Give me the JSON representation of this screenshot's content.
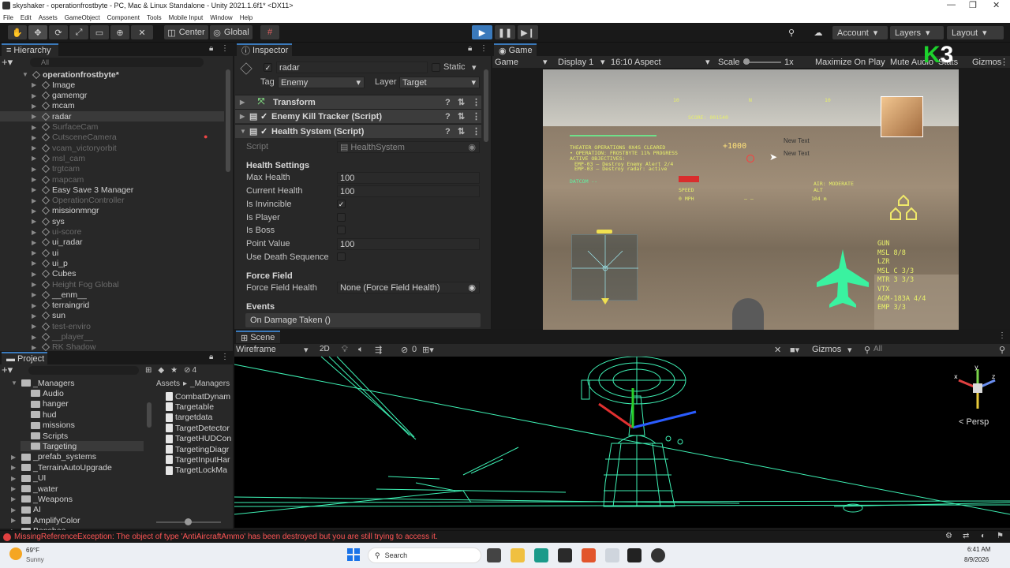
{
  "window": {
    "title": "skyshaker - operationfrostbyte - PC, Mac & Linux Standalone - Unity 2021.1.6f1* <DX11>",
    "controls": [
      "—",
      "❐",
      "✕"
    ]
  },
  "menu": [
    "File",
    "Edit",
    "Assets",
    "GameObject",
    "Component",
    "Tools",
    "Mobile Input",
    "Window",
    "Help"
  ],
  "toolbar": {
    "pivot": "Center",
    "space": "Global",
    "account": "Account",
    "layers": "Layers",
    "layout": "Layout"
  },
  "hierarchy": {
    "tab": "Hierarchy",
    "search_placeholder": "All",
    "items": [
      {
        "label": "operationfrostbyte*",
        "dim": false
      },
      {
        "label": "Image",
        "dim": false
      },
      {
        "label": "gamemgr",
        "dim": false
      },
      {
        "label": "mcam",
        "dim": false
      },
      {
        "label": "radar",
        "dim": false
      },
      {
        "label": "SurfaceCam",
        "dim": true
      },
      {
        "label": "CutsceneCamera",
        "dim": true
      },
      {
        "label": "vcam_victoryorbit",
        "dim": true
      },
      {
        "label": "msl_cam",
        "dim": true
      },
      {
        "label": "trgtcam",
        "dim": true
      },
      {
        "label": "mapcam",
        "dim": true
      },
      {
        "label": "Easy Save 3 Manager",
        "dim": false
      },
      {
        "label": "OperationController",
        "dim": true
      },
      {
        "label": "missionmngr",
        "dim": false
      },
      {
        "label": "sys",
        "dim": false
      },
      {
        "label": "ui-score",
        "dim": true
      },
      {
        "label": "ui_radar",
        "dim": false
      },
      {
        "label": "ui",
        "dim": false
      },
      {
        "label": "ui_p",
        "dim": false
      },
      {
        "label": "Cubes",
        "dim": false
      },
      {
        "label": "Height Fog Global",
        "dim": true
      },
      {
        "label": "__enm__",
        "dim": false
      },
      {
        "label": "terraingrid",
        "dim": false
      },
      {
        "label": "sun",
        "dim": false
      },
      {
        "label": "test-enviro",
        "dim": true
      },
      {
        "label": "__player__",
        "dim": true
      },
      {
        "label": "RK Shadow",
        "dim": true
      }
    ]
  },
  "inspector": {
    "tab": "Inspector",
    "object_name": "radar",
    "static_label": "Static",
    "tag_label": "Tag",
    "tag_value": "Enemy",
    "layer_label": "Layer",
    "layer_value": "Target",
    "components": [
      "Transform",
      "Enemy Kill Tracker (Script)",
      "Health System (Script)"
    ],
    "script_label": "Script",
    "script_value": "HealthSystem",
    "health_settings": "Health Settings",
    "fields": {
      "max_health_label": "Max Health",
      "max_health": "100",
      "current_health_label": "Current Health",
      "current_health": "100",
      "is_invincible_label": "Is Invincible",
      "is_player_label": "Is Player",
      "is_boss_label": "Is Boss",
      "point_value_label": "Point Value",
      "point_value": "100",
      "use_death_label": "Use Death Sequence"
    },
    "force_field": "Force Field",
    "force_field_health_label": "Force Field Health",
    "force_field_health_value": "None (Force Field Health)",
    "events": "Events",
    "on_damage": "On Damage Taken ()"
  },
  "game": {
    "tab": "Game",
    "mode": "Game",
    "display": "Display 1",
    "aspect": "16:10 Aspect",
    "scale_label": "Scale",
    "scale_value": "1x",
    "maximize": "Maximize On Play",
    "mute": "Mute Audio",
    "stats": "Stats",
    "gizmos": "Gizmos",
    "hud": {
      "score": "SCORE: 001540",
      "plus": "+1000",
      "new_text_1": "New Text",
      "new_text_2": "New Text",
      "theater": "THEATER OPERATIONS 0X4S CLEARED",
      "operation": "• OPERATION: FROSTBYTE 11% PROGRESS",
      "active": "ACTIVE OBJECTIVES:",
      "obj1": "EMP-03 — Destroy Enemy Alert 2/4",
      "obj2": "EMP-03 — Destroy radar: active",
      "speed_label": "SPEED",
      "speed_value": "0 MPH",
      "alt_label": "ALT",
      "alt_value": "104 m",
      "air": "AIR: MODERATE",
      "weapons": [
        "GUN",
        "MSL 8/8",
        "LZR",
        "MSL C 3/3",
        "MTR 3 3/3",
        "VTX",
        "AGM-183A 4/4",
        "EMP 3/3"
      ],
      "watermark": "K3"
    }
  },
  "scene": {
    "tab": "Scene",
    "shading": "Wireframe",
    "mode_2d": "2D",
    "hidden_count": "0",
    "gizmos": "Gizmos",
    "search": "All",
    "persp": "< Persp"
  },
  "project": {
    "tab": "Project",
    "tree": [
      {
        "label": "_Managers",
        "indent": 1
      },
      {
        "label": "Audio",
        "indent": 2
      },
      {
        "label": "hanger",
        "indent": 2
      },
      {
        "label": "hud",
        "indent": 2
      },
      {
        "label": "missions",
        "indent": 2
      },
      {
        "label": "Scripts",
        "indent": 2
      },
      {
        "label": "Targeting",
        "indent": 2
      },
      {
        "label": "_prefab_systems",
        "indent": 1
      },
      {
        "label": "_TerrainAutoUpgrade",
        "indent": 1
      },
      {
        "label": "_UI",
        "indent": 1
      },
      {
        "label": "_water",
        "indent": 1
      },
      {
        "label": "_Weapons",
        "indent": 1
      },
      {
        "label": "AI",
        "indent": 1
      },
      {
        "label": "AmplifyColor",
        "indent": 1
      },
      {
        "label": "Banshee",
        "indent": 1
      }
    ],
    "breadcrumb": [
      "Assets",
      "_Managers"
    ],
    "hidden_count": "4",
    "files": [
      "CombatDynam",
      "Targetable",
      "targetdata",
      "TargetDetector",
      "TargetHUDCon",
      "TargetingDiagr",
      "TargetInputHar",
      "TargetLockMa"
    ]
  },
  "status": {
    "error": "MissingReferenceException: The object of type 'AntiAircraftAmmo' has been destroyed but you are still trying to access it."
  },
  "taskbar": {
    "weather_temp": "69°F",
    "weather_desc": "Sunny",
    "search": "Search",
    "time": "6:41 AM",
    "date": "8/9/2026"
  },
  "colors": {
    "accent": "#3a79bb",
    "wire": "#3ef2b5",
    "hud": "#e8f06a",
    "error": "#ff5555"
  }
}
